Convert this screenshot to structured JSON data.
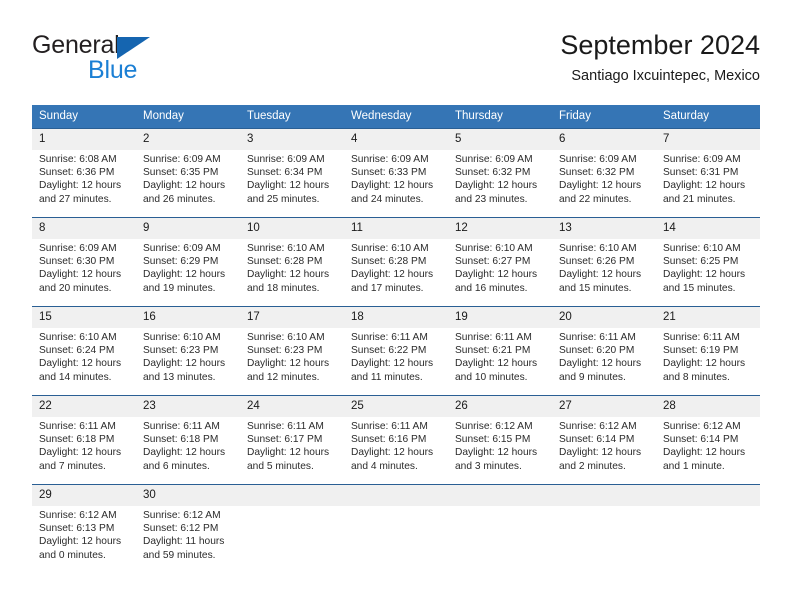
{
  "logo": {
    "word_top": "General",
    "word_bottom": "Blue",
    "triangle_icon": "blue-triangle-icon",
    "brand_color": "#1b7fd4"
  },
  "header": {
    "title": "September 2024",
    "subtitle": "Santiago Ixcuintepec, Mexico",
    "header_bg_color": "#3575b5",
    "row_rule_color": "#2a5f94",
    "daynum_band_color": "#f0f0f0"
  },
  "weekdays": [
    "Sunday",
    "Monday",
    "Tuesday",
    "Wednesday",
    "Thursday",
    "Friday",
    "Saturday"
  ],
  "labels": {
    "sunrise": "Sunrise:",
    "sunset": "Sunset:",
    "daylight": "Daylight:"
  },
  "weeks": [
    [
      {
        "day": "1",
        "sunrise": "Sunrise: 6:08 AM",
        "sunset": "Sunset: 6:36 PM",
        "daylight_line1": "Daylight: 12 hours",
        "daylight_line2": "and 27 minutes."
      },
      {
        "day": "2",
        "sunrise": "Sunrise: 6:09 AM",
        "sunset": "Sunset: 6:35 PM",
        "daylight_line1": "Daylight: 12 hours",
        "daylight_line2": "and 26 minutes."
      },
      {
        "day": "3",
        "sunrise": "Sunrise: 6:09 AM",
        "sunset": "Sunset: 6:34 PM",
        "daylight_line1": "Daylight: 12 hours",
        "daylight_line2": "and 25 minutes."
      },
      {
        "day": "4",
        "sunrise": "Sunrise: 6:09 AM",
        "sunset": "Sunset: 6:33 PM",
        "daylight_line1": "Daylight: 12 hours",
        "daylight_line2": "and 24 minutes."
      },
      {
        "day": "5",
        "sunrise": "Sunrise: 6:09 AM",
        "sunset": "Sunset: 6:32 PM",
        "daylight_line1": "Daylight: 12 hours",
        "daylight_line2": "and 23 minutes."
      },
      {
        "day": "6",
        "sunrise": "Sunrise: 6:09 AM",
        "sunset": "Sunset: 6:32 PM",
        "daylight_line1": "Daylight: 12 hours",
        "daylight_line2": "and 22 minutes."
      },
      {
        "day": "7",
        "sunrise": "Sunrise: 6:09 AM",
        "sunset": "Sunset: 6:31 PM",
        "daylight_line1": "Daylight: 12 hours",
        "daylight_line2": "and 21 minutes."
      }
    ],
    [
      {
        "day": "8",
        "sunrise": "Sunrise: 6:09 AM",
        "sunset": "Sunset: 6:30 PM",
        "daylight_line1": "Daylight: 12 hours",
        "daylight_line2": "and 20 minutes."
      },
      {
        "day": "9",
        "sunrise": "Sunrise: 6:09 AM",
        "sunset": "Sunset: 6:29 PM",
        "daylight_line1": "Daylight: 12 hours",
        "daylight_line2": "and 19 minutes."
      },
      {
        "day": "10",
        "sunrise": "Sunrise: 6:10 AM",
        "sunset": "Sunset: 6:28 PM",
        "daylight_line1": "Daylight: 12 hours",
        "daylight_line2": "and 18 minutes."
      },
      {
        "day": "11",
        "sunrise": "Sunrise: 6:10 AM",
        "sunset": "Sunset: 6:28 PM",
        "daylight_line1": "Daylight: 12 hours",
        "daylight_line2": "and 17 minutes."
      },
      {
        "day": "12",
        "sunrise": "Sunrise: 6:10 AM",
        "sunset": "Sunset: 6:27 PM",
        "daylight_line1": "Daylight: 12 hours",
        "daylight_line2": "and 16 minutes."
      },
      {
        "day": "13",
        "sunrise": "Sunrise: 6:10 AM",
        "sunset": "Sunset: 6:26 PM",
        "daylight_line1": "Daylight: 12 hours",
        "daylight_line2": "and 15 minutes."
      },
      {
        "day": "14",
        "sunrise": "Sunrise: 6:10 AM",
        "sunset": "Sunset: 6:25 PM",
        "daylight_line1": "Daylight: 12 hours",
        "daylight_line2": "and 15 minutes."
      }
    ],
    [
      {
        "day": "15",
        "sunrise": "Sunrise: 6:10 AM",
        "sunset": "Sunset: 6:24 PM",
        "daylight_line1": "Daylight: 12 hours",
        "daylight_line2": "and 14 minutes."
      },
      {
        "day": "16",
        "sunrise": "Sunrise: 6:10 AM",
        "sunset": "Sunset: 6:23 PM",
        "daylight_line1": "Daylight: 12 hours",
        "daylight_line2": "and 13 minutes."
      },
      {
        "day": "17",
        "sunrise": "Sunrise: 6:10 AM",
        "sunset": "Sunset: 6:23 PM",
        "daylight_line1": "Daylight: 12 hours",
        "daylight_line2": "and 12 minutes."
      },
      {
        "day": "18",
        "sunrise": "Sunrise: 6:11 AM",
        "sunset": "Sunset: 6:22 PM",
        "daylight_line1": "Daylight: 12 hours",
        "daylight_line2": "and 11 minutes."
      },
      {
        "day": "19",
        "sunrise": "Sunrise: 6:11 AM",
        "sunset": "Sunset: 6:21 PM",
        "daylight_line1": "Daylight: 12 hours",
        "daylight_line2": "and 10 minutes."
      },
      {
        "day": "20",
        "sunrise": "Sunrise: 6:11 AM",
        "sunset": "Sunset: 6:20 PM",
        "daylight_line1": "Daylight: 12 hours",
        "daylight_line2": "and 9 minutes."
      },
      {
        "day": "21",
        "sunrise": "Sunrise: 6:11 AM",
        "sunset": "Sunset: 6:19 PM",
        "daylight_line1": "Daylight: 12 hours",
        "daylight_line2": "and 8 minutes."
      }
    ],
    [
      {
        "day": "22",
        "sunrise": "Sunrise: 6:11 AM",
        "sunset": "Sunset: 6:18 PM",
        "daylight_line1": "Daylight: 12 hours",
        "daylight_line2": "and 7 minutes."
      },
      {
        "day": "23",
        "sunrise": "Sunrise: 6:11 AM",
        "sunset": "Sunset: 6:18 PM",
        "daylight_line1": "Daylight: 12 hours",
        "daylight_line2": "and 6 minutes."
      },
      {
        "day": "24",
        "sunrise": "Sunrise: 6:11 AM",
        "sunset": "Sunset: 6:17 PM",
        "daylight_line1": "Daylight: 12 hours",
        "daylight_line2": "and 5 minutes."
      },
      {
        "day": "25",
        "sunrise": "Sunrise: 6:11 AM",
        "sunset": "Sunset: 6:16 PM",
        "daylight_line1": "Daylight: 12 hours",
        "daylight_line2": "and 4 minutes."
      },
      {
        "day": "26",
        "sunrise": "Sunrise: 6:12 AM",
        "sunset": "Sunset: 6:15 PM",
        "daylight_line1": "Daylight: 12 hours",
        "daylight_line2": "and 3 minutes."
      },
      {
        "day": "27",
        "sunrise": "Sunrise: 6:12 AM",
        "sunset": "Sunset: 6:14 PM",
        "daylight_line1": "Daylight: 12 hours",
        "daylight_line2": "and 2 minutes."
      },
      {
        "day": "28",
        "sunrise": "Sunrise: 6:12 AM",
        "sunset": "Sunset: 6:14 PM",
        "daylight_line1": "Daylight: 12 hours",
        "daylight_line2": "and 1 minute."
      }
    ],
    [
      {
        "day": "29",
        "sunrise": "Sunrise: 6:12 AM",
        "sunset": "Sunset: 6:13 PM",
        "daylight_line1": "Daylight: 12 hours",
        "daylight_line2": "and 0 minutes."
      },
      {
        "day": "30",
        "sunrise": "Sunrise: 6:12 AM",
        "sunset": "Sunset: 6:12 PM",
        "daylight_line1": "Daylight: 11 hours",
        "daylight_line2": "and 59 minutes."
      },
      {
        "day": "",
        "sunrise": "",
        "sunset": "",
        "daylight_line1": "",
        "daylight_line2": ""
      },
      {
        "day": "",
        "sunrise": "",
        "sunset": "",
        "daylight_line1": "",
        "daylight_line2": ""
      },
      {
        "day": "",
        "sunrise": "",
        "sunset": "",
        "daylight_line1": "",
        "daylight_line2": ""
      },
      {
        "day": "",
        "sunrise": "",
        "sunset": "",
        "daylight_line1": "",
        "daylight_line2": ""
      },
      {
        "day": "",
        "sunrise": "",
        "sunset": "",
        "daylight_line1": "",
        "daylight_line2": ""
      }
    ]
  ]
}
